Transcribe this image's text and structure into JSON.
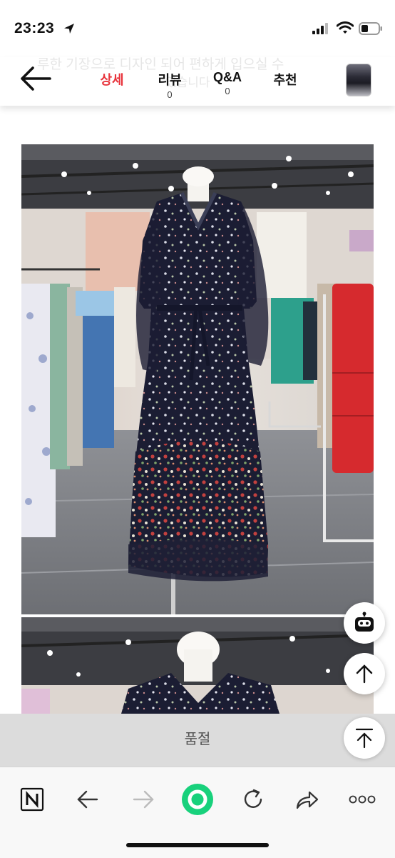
{
  "status": {
    "time": "23:23"
  },
  "header": {
    "ghost_text_1": "루한 기장으로 디자인 되어 편하게 입으실 수",
    "ghost_text_2": "있습니다",
    "tabs": [
      {
        "label": "상세",
        "count": "",
        "active": true
      },
      {
        "label": "리뷰",
        "count": "0",
        "active": false
      },
      {
        "label": "Q&A",
        "count": "0",
        "active": false
      },
      {
        "label": "추천",
        "count": "",
        "active": false
      }
    ]
  },
  "icons": {
    "back": "back-arrow-icon",
    "chatbot": "chatbot-icon",
    "scroll_top": "arrow-up-icon",
    "scroll_top_bar": "arrow-up-to-line-icon"
  },
  "product": {
    "soldout_label": "품절"
  },
  "colors": {
    "accent": "#e8343c",
    "green": "#18d17c",
    "dress": "#1b1d33"
  }
}
